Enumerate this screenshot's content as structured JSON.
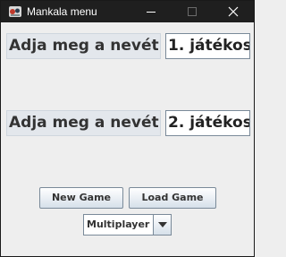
{
  "window": {
    "title": "Mankala menu",
    "icon": "mankala-app-icon",
    "controls": [
      "minimize-icon",
      "maximize-icon",
      "close-icon"
    ]
  },
  "player1": {
    "label": "Adja meg a nevét:",
    "value": "1. játékos"
  },
  "player2": {
    "label": "Adja meg a nevét:",
    "value": "2. játékos"
  },
  "buttons": {
    "new_game": "New Game",
    "load_game": "Load Game"
  },
  "mode_select": {
    "selected": "Multiplayer",
    "icon": "chevron-down-icon"
  },
  "colors": {
    "titlebar": "#1f1f1f",
    "background": "#eeeeee",
    "label_bg": "#e3e7ec"
  }
}
